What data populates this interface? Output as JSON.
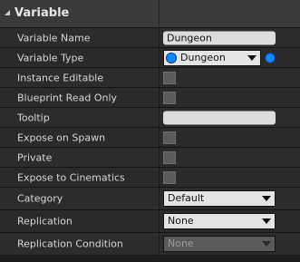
{
  "section": {
    "title": "Variable"
  },
  "fields": {
    "variable_name": {
      "label": "Variable Name",
      "value": "Dungeon"
    },
    "variable_type": {
      "label": "Variable Type",
      "value": "Dungeon"
    },
    "instance_editable": {
      "label": "Instance Editable",
      "checked": false
    },
    "blueprint_read_only": {
      "label": "Blueprint Read Only",
      "checked": false
    },
    "tooltip": {
      "label": "Tooltip",
      "value": ""
    },
    "expose_on_spawn": {
      "label": "Expose on Spawn",
      "checked": false
    },
    "private": {
      "label": "Private",
      "checked": false
    },
    "expose_to_cinematics": {
      "label": "Expose to Cinematics",
      "checked": false
    },
    "category": {
      "label": "Category",
      "value": "Default"
    },
    "replication": {
      "label": "Replication",
      "value": "None"
    },
    "replication_condition": {
      "label": "Replication Condition",
      "value": "None",
      "enabled": false
    }
  },
  "colors": {
    "pin": "#1188ff",
    "header_bg": "#3a3a3a",
    "row_bg": "#2c2c2c"
  },
  "icons": {
    "section_toggle": "expanded-triangle-icon",
    "type_pin": "object-pin-icon",
    "type_pin_outside": "object-pin-icon"
  }
}
